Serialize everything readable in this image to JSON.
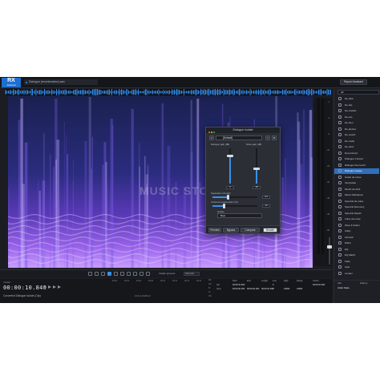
{
  "app": {
    "name": "RX",
    "edition": "Advanced"
  },
  "file_tab": "Dialogue (reverberation).wav",
  "repair_assistant": "Repair Assistant",
  "dialog": {
    "title": "Dialogue Isolate",
    "preset": "[Default]",
    "dialogue_gain_label": "Dialogue gain (dB)",
    "noise_gain_label": "Noise gain (dB)",
    "dialogue_gain_value": "0",
    "noise_gain_value": "-20",
    "dialogue_gain_level": 0.78,
    "noise_gain_level": 0.42,
    "separation_label": "Separation strength",
    "separation_value": "2.0",
    "separation_level": 0.35,
    "ambience_label": "Ambience preservation (%)",
    "ambience_value": "10",
    "ambience_level": 0.25,
    "quality_label": "Quality",
    "quality_value": "Best",
    "preview": "Preview",
    "bypass": "Bypass",
    "compare": "Compare",
    "render": "Render"
  },
  "watermark": "MUSIC STORE",
  "db_ticks": [
    "-1",
    "-3",
    "-6",
    "-10",
    "-15",
    "-20",
    "-30",
    "-40",
    "-60",
    "-80"
  ],
  "toolbar": {
    "harmonics_label": "Instant process",
    "harmonics_mode": "Attenuate"
  },
  "transport": {
    "instant_label": "Instant",
    "timecode": "00:00:10.840",
    "status": "Converted Dialogue Isolate (Clip)",
    "ruler": [
      "00:02",
      "00:04",
      "00:06",
      "00:08",
      "00:10",
      "00:12",
      "00:14",
      "00:16"
    ],
    "bottom_label": "24-bit | 44100 Hz",
    "hz": [
      "20k",
      "10k",
      "5k",
      "1k",
      "100"
    ]
  },
  "selection": {
    "headers": [
      "Start",
      "End",
      "Length",
      "Low",
      "High",
      "Range",
      "Cursor"
    ],
    "sel_label": "Sel",
    "view_label": "View",
    "sel": [
      "00:00:10.840",
      "",
      "",
      "0",
      "",
      "",
      "00:00:10.840"
    ],
    "view": [
      "00:00:00.000",
      "00:00:20.000",
      "00:00:20.000",
      "0",
      "24000",
      "24000",
      ""
    ]
  },
  "modules": [
    "De-click",
    "De-clip",
    "De-crackle",
    "De-ess",
    "De-hum",
    "De-plosive",
    "De-reverb",
    "De-rustle",
    "De-wind",
    "Deconstruct",
    "Dialogue Contour",
    "Dialogue De-reverb",
    "Dialogue Isolate",
    "Guitar de-noise",
    "Interpolate",
    "Mouth de-click",
    "Music Rebalance",
    "Spectral de-noise",
    "Spectral Recovery",
    "Spectral Repair",
    "Voice de-noise",
    "Wow & Flutter",
    "Utility",
    "Azimuth",
    "Dither",
    "EQ",
    "EQ Match",
    "Fade",
    "Gain",
    "Leveler"
  ],
  "selected_module": "Dialogue Isolate",
  "module_filter": "All",
  "history": {
    "tabs": [
      "Info",
      "History"
    ],
    "state": "Initial State"
  }
}
